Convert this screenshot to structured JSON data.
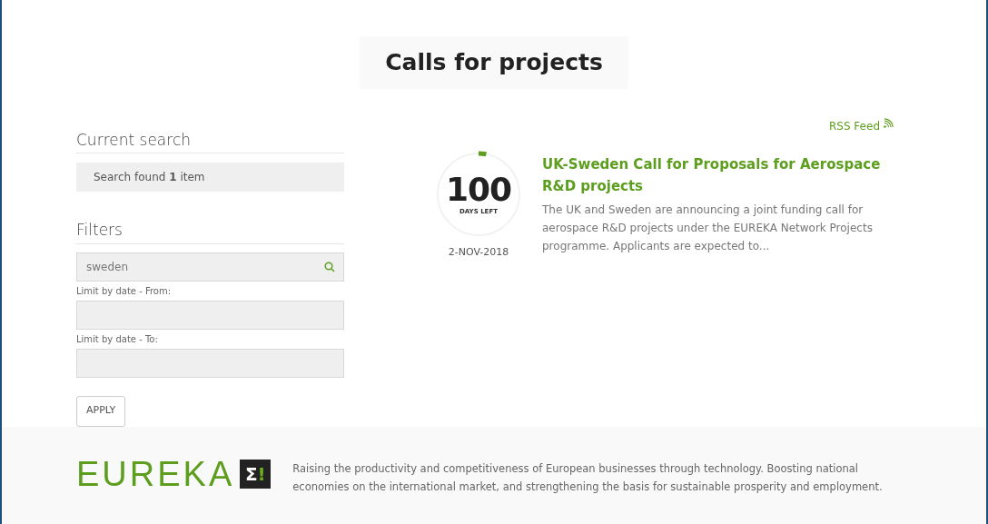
{
  "page_title": "Calls for projects",
  "current_search": {
    "heading": "Current search",
    "summary": "Search found **1** item"
  },
  "filters": {
    "heading": "Filters",
    "search": {
      "value": "sweden"
    },
    "date_fields": [
      {
        "label": "Limit by date - From:"
      },
      {
        "label": "Limit by date - To:"
      }
    ],
    "apply_button": "APPLY"
  },
  "rss_link": "RSS Feed",
  "results": [
    {
      "days": "100",
      "days_label": "DAYS LEFT",
      "level": 0.03,
      "date": "2-NOV-2018",
      "title": "UK-Sweden Call for Proposals for Aerospace R&D projects",
      "summary": "The UK and Sweden are announcing a joint funding call for aerospace R&D projects under the EUREKA Network Projects programme. Applicants are expected to..."
    }
  ],
  "footer": {
    "logo_text": "EUREKA",
    "logo_mark": [
      "Σ",
      "!"
    ],
    "tagline": "Raising the productivity and competitiveness of European businesses through technology. Boosting national economies on the international market, and strengthening the basis for sustainable prosperity and employment."
  }
}
